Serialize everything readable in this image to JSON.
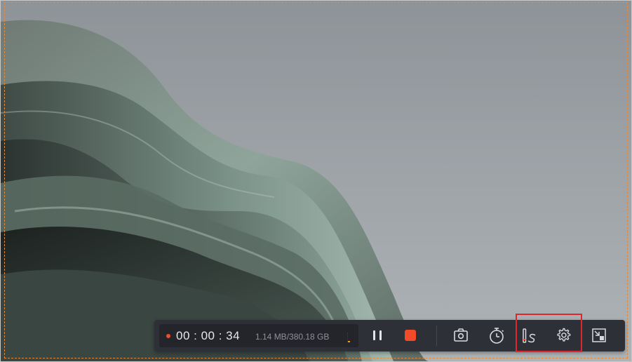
{
  "recorder": {
    "status": "recording",
    "elapsed_time": "00 : 00 : 34",
    "file_size": "1.14 MB/380.18 GB",
    "level_indicator": 0.1,
    "buttons": [
      {
        "name": "pause",
        "icon": "pause-icon"
      },
      {
        "name": "stop",
        "icon": "stop-icon"
      },
      {
        "name": "screenshot",
        "icon": "camera-icon"
      },
      {
        "name": "schedule",
        "icon": "timer-icon"
      },
      {
        "name": "annotate",
        "icon": "pen-icon"
      },
      {
        "name": "settings",
        "icon": "gear-icon"
      },
      {
        "name": "minimize",
        "icon": "minimize-icon"
      }
    ],
    "highlighted_buttons": [
      "annotate",
      "settings"
    ]
  },
  "colors": {
    "recording_dot": "#f24b29",
    "stop_button": "#f24b29",
    "toolbar_bg": "#2e3038",
    "region_border": "#e58a3c",
    "highlight": "#e0262a"
  },
  "background": {
    "description": "desktop wallpaper with flowing sage-green curves"
  }
}
